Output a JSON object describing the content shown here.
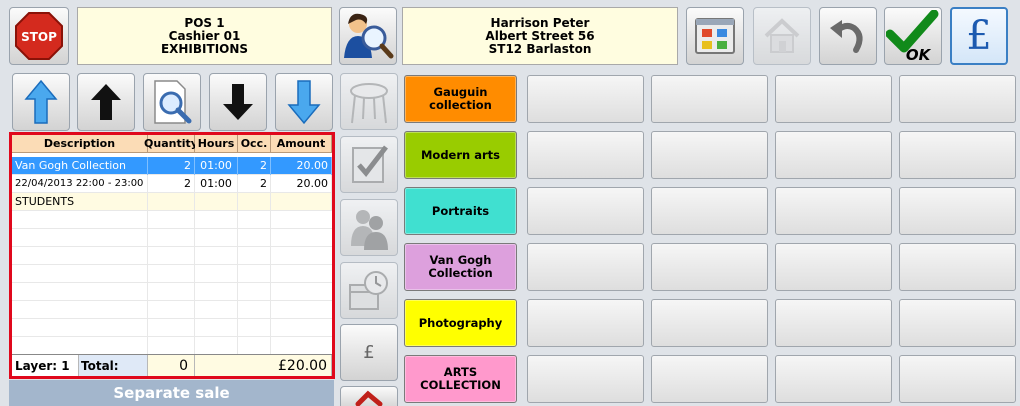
{
  "header": {
    "pos_lines": [
      "POS 1",
      "Cashier 01",
      "EXHIBITIONS"
    ],
    "customer_lines": [
      "Harrison  Peter",
      "Albert Street 56",
      "ST12 Barlaston"
    ],
    "stop_label": "STOP",
    "ok_label": "OK",
    "pound_symbol": "£"
  },
  "side": {
    "pound_symbol": "£"
  },
  "grid": {
    "columns": [
      "Description",
      "Quantity",
      "Hours",
      "Occ.",
      "Amount"
    ],
    "rows": [
      {
        "description": "Van Gogh Collection",
        "quantity": "2",
        "hours": "01:00",
        "occ": "2",
        "amount": "20.00"
      },
      {
        "description": "22/04/2013 22:00 - 23:00",
        "quantity": "2",
        "hours": "01:00",
        "occ": "2",
        "amount": "20.00"
      },
      {
        "description": "STUDENTS",
        "quantity": "",
        "hours": "",
        "occ": "",
        "amount": ""
      }
    ],
    "layer_label": "Layer: 1",
    "total_label": "Total:",
    "total_quantity": "0",
    "total_amount": "£20.00"
  },
  "separate_sale_label": "Separate sale",
  "categories": [
    {
      "lines": [
        "Gauguin",
        "collection"
      ],
      "color": "#ff8c00"
    },
    {
      "lines": [
        "Modern arts"
      ],
      "color": "#99cc00"
    },
    {
      "lines": [
        "Portraits"
      ],
      "color": "#40e0d0"
    },
    {
      "lines": [
        "Van Gogh",
        "Collection"
      ],
      "color": "#dda0dd"
    },
    {
      "lines": [
        "Photography"
      ],
      "color": "#ffff00"
    },
    {
      "lines": [
        "ARTS",
        "COLLECTION"
      ],
      "color": "#ff99cc"
    }
  ],
  "colors": {
    "selection": "#3399ff",
    "highlight_border": "#e0081c",
    "header_bg": "#fbdcb6",
    "info_bg": "#fffde0"
  }
}
